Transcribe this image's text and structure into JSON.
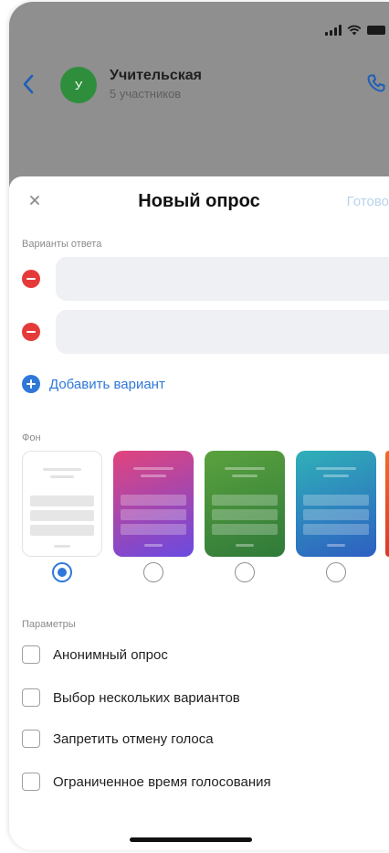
{
  "chat": {
    "avatar_letter": "У",
    "title": "Учительская",
    "subtitle": "5 участников"
  },
  "sheet": {
    "title": "Новый опрос",
    "done": "Готово",
    "answers_label": "Варианты ответа",
    "options": [
      {
        "value": "",
        "placeholder": ""
      },
      {
        "value": "",
        "placeholder": ""
      }
    ],
    "add_option": "Добавить вариант",
    "background_label": "Фон",
    "backgrounds": [
      {
        "name": "white",
        "selected": true,
        "colors": [
          "#ffffff",
          "#ffffff"
        ]
      },
      {
        "name": "pink-purple",
        "selected": false,
        "colors": [
          "#e2447c",
          "#6a4ae0"
        ]
      },
      {
        "name": "green",
        "selected": false,
        "colors": [
          "#5aa23e",
          "#2f7a3a"
        ]
      },
      {
        "name": "teal-blue",
        "selected": false,
        "colors": [
          "#2fb0b8",
          "#2e5fc2"
        ]
      },
      {
        "name": "orange",
        "selected": false,
        "colors": [
          "#f06b2a",
          "#d93a2b"
        ]
      }
    ],
    "params_label": "Параметры",
    "params": [
      {
        "label": "Анонимный опрос",
        "checked": false
      },
      {
        "label": "Выбор нескольких вариантов",
        "checked": false
      },
      {
        "label": "Запретить отмену голоса",
        "checked": false
      },
      {
        "label": "Ограниченное время голосования",
        "checked": false
      }
    ]
  },
  "colors": {
    "accent": "#2f78d8",
    "remove": "#e53a3a",
    "done_disabled": "#b9d3ec",
    "overlay": "#8f8f8f"
  }
}
